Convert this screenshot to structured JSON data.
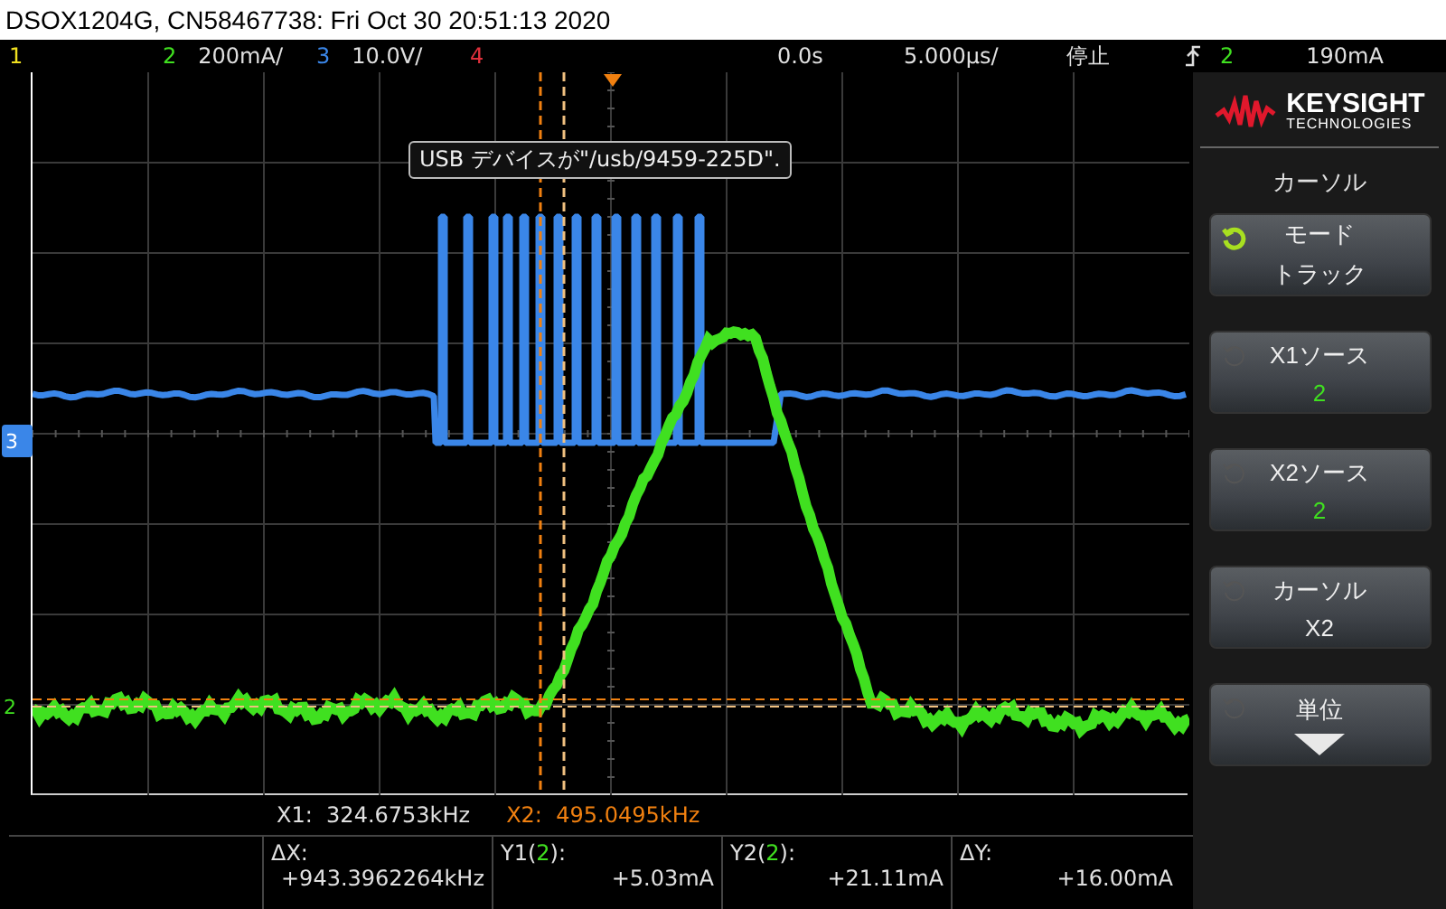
{
  "window": {
    "title": "DSOX1204G, CN58467738: Fri Oct 30 20:51:13 2020"
  },
  "channels": [
    {
      "number": "1",
      "color": "#f0e020"
    },
    {
      "number": "2",
      "scale": "200mA/",
      "color": "#40e020"
    },
    {
      "number": "3",
      "scale": "10.0V/",
      "color": "#3a86e8"
    },
    {
      "number": "4",
      "color": "#e0303c"
    }
  ],
  "timebase": {
    "delay": "0.0s",
    "scale": "5.000µs/",
    "run_state": "停止"
  },
  "trigger": {
    "source": "2",
    "level": "190mA"
  },
  "message": "USB デバイスが\"/usb/9459-225D\".",
  "ground_markers": [
    {
      "label": "3",
      "color": "#3a86e8"
    },
    {
      "label": "2",
      "color": "#40e020"
    }
  ],
  "brand": {
    "name": "KEYSIGHT",
    "sub": "TECHNOLOGIES"
  },
  "menu_title": "カーソル",
  "softkeys": [
    {
      "kind": "text",
      "label": "モード",
      "value": "トラック",
      "knob_active": true
    },
    {
      "kind": "channel",
      "label": "X1ソース",
      "value": "2",
      "knob_active": false
    },
    {
      "kind": "channel",
      "label": "X2ソース",
      "value": "2",
      "knob_active": false
    },
    {
      "kind": "text",
      "label": "カーソル",
      "value": "X2",
      "knob_active": false
    },
    {
      "kind": "submenu",
      "label": "単位",
      "knob_active": false
    }
  ],
  "cursor_readout": [
    {
      "label": "X1:",
      "value": "324.6753kHz",
      "selected": false
    },
    {
      "label": "X2:",
      "value": "495.0495kHz",
      "selected": true
    }
  ],
  "measurements": [
    {
      "label_before": "ΔX:",
      "value": "+943.3962264kHz"
    },
    {
      "label_before": "Y1(",
      "source": "2",
      "label_after": "):",
      "value": "+5.03mA"
    },
    {
      "label_before": "Y2(",
      "source": "2",
      "label_after": "):",
      "value": "+21.11mA"
    },
    {
      "label_before": "ΔY:",
      "value": "+16.00mA"
    }
  ]
}
